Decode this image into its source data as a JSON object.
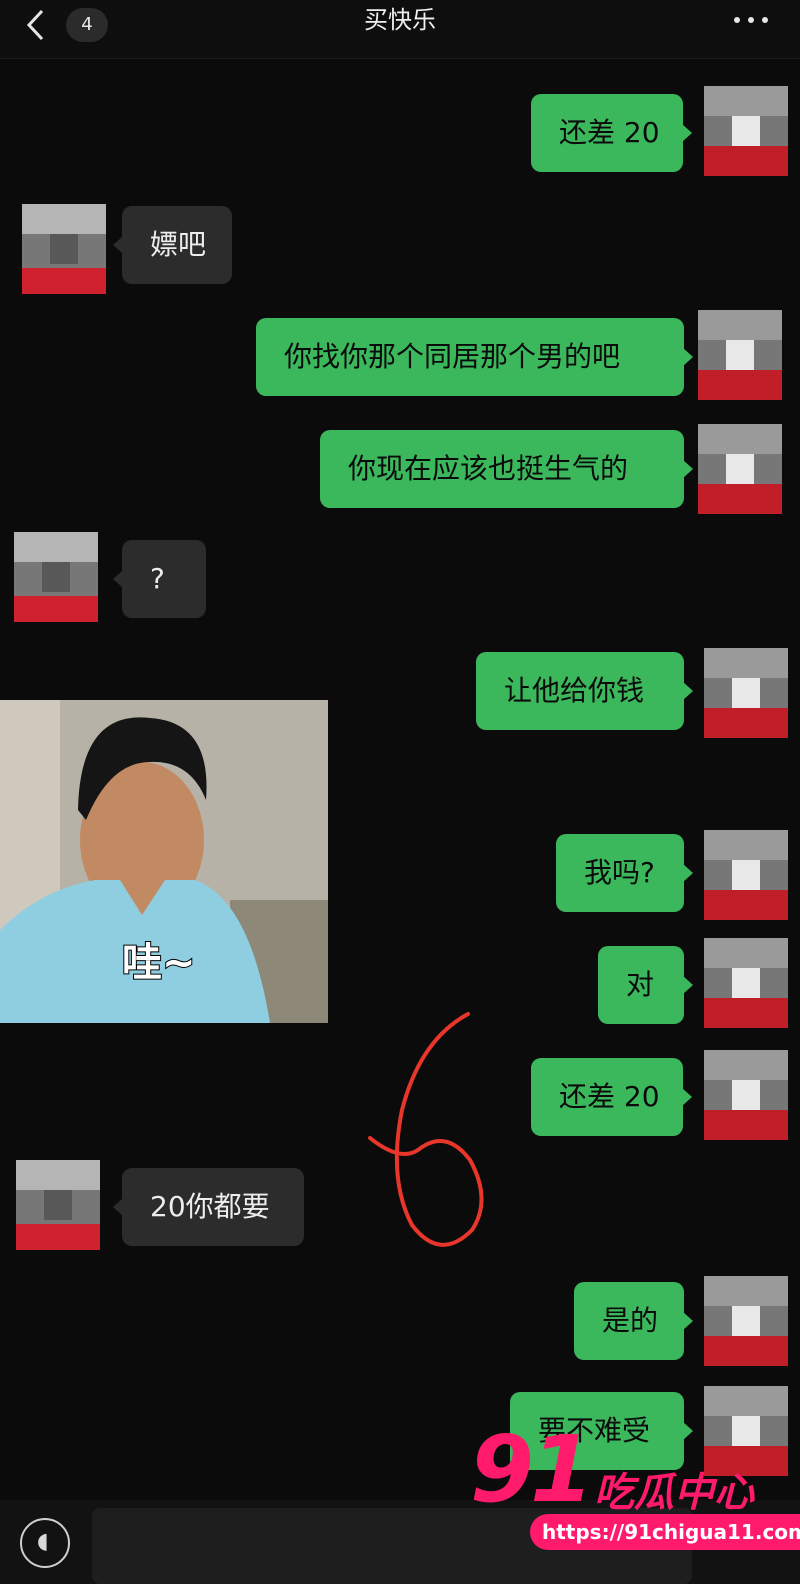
{
  "header": {
    "back_count": "4",
    "title": "买快乐"
  },
  "messages": [
    {
      "side": "out",
      "text": "还差 20"
    },
    {
      "side": "in",
      "text": "嫖吧"
    },
    {
      "side": "out",
      "text": "你找你那个同居那个男的吧"
    },
    {
      "side": "out",
      "text": "你现在应该也挺生气的"
    },
    {
      "side": "in",
      "text": "?"
    },
    {
      "side": "out",
      "text": "让他给你钱"
    },
    {
      "side": "in",
      "type": "sticker",
      "caption": "哇~"
    },
    {
      "side": "out",
      "text": "我吗?"
    },
    {
      "side": "out",
      "text": "对"
    },
    {
      "side": "out",
      "text": "还差 20"
    },
    {
      "side": "in",
      "text": "20你都要"
    },
    {
      "side": "out",
      "text": "是的"
    },
    {
      "side": "out",
      "text": "要不难受"
    }
  ],
  "annotation": {
    "text": "6",
    "color": "#e8362b"
  },
  "watermark": {
    "number": "91",
    "name": "吃瓜中心",
    "url": "https://91chigua11.com"
  },
  "colors": {
    "outgoing_bubble": "#3bb85c",
    "incoming_bubble": "#2c2c2c",
    "background": "#0b0b0b",
    "watermark": "#ff1a6b"
  }
}
